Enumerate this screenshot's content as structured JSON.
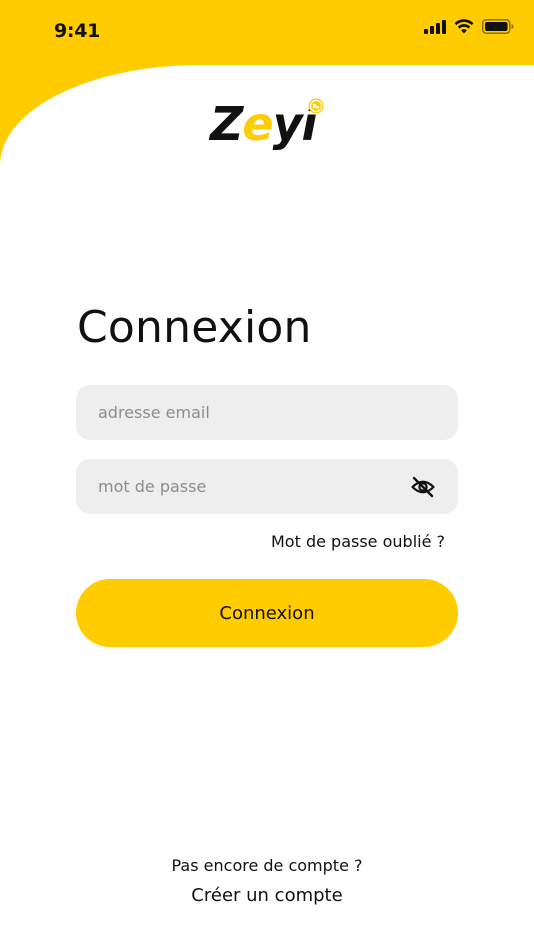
{
  "status_bar": {
    "time": "9:41",
    "icons": [
      "signal-icon",
      "wifi-icon",
      "battery-icon"
    ]
  },
  "logo": {
    "prefix": "Z",
    "accent": "e",
    "suffix": "yi",
    "icon": "globe-icon"
  },
  "login": {
    "title": "Connexion",
    "email_placeholder": "adresse email",
    "password_placeholder": "mot de passe",
    "password_toggle_icon": "eye-off-icon",
    "forgot_password": "Mot de passe oublié ?",
    "submit_label": "Connexion"
  },
  "footer": {
    "no_account": "Pas encore de compte ?",
    "create_account": "Créer un compte"
  },
  "colors": {
    "brand_yellow": "#FFCC00",
    "field_background": "#EEEEEE",
    "text": "#111111"
  }
}
